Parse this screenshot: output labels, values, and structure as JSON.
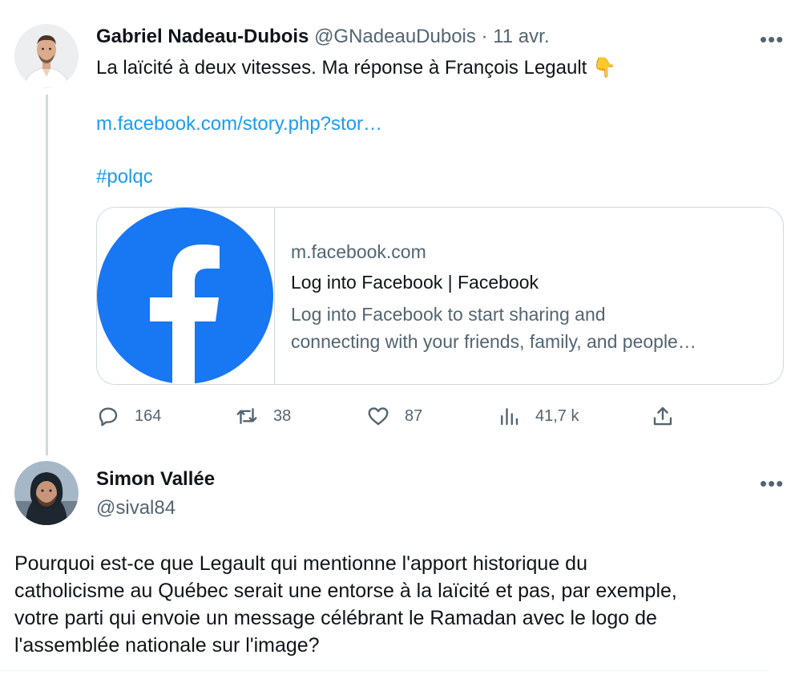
{
  "colors": {
    "text": "#0f1419",
    "muted": "#536471",
    "link": "#1d9bf0",
    "border": "#cfd9de",
    "facebook_blue": "#1877f2"
  },
  "tweet1": {
    "author_name": "Gabriel Nadeau-Dubois",
    "handle": "@GNadeauDubois",
    "separator": "·",
    "date": "11 avr.",
    "more_icon": "more-options-icon",
    "text": "La laïcité à deux vitesses. Ma réponse à François Legault 👇",
    "link_text": "m.facebook.com/story.php?stor…",
    "hashtag": "#polqc",
    "card": {
      "image_icon": "facebook-logo-icon",
      "domain": "m.facebook.com",
      "title": "Log into Facebook | Facebook",
      "description_line1": "Log into Facebook to start sharing and",
      "description_line2": "connecting with your friends, family, and people…"
    },
    "actions": {
      "reply_count": "164",
      "retweet_count": "38",
      "like_count": "87",
      "views_count": "41,7 k",
      "reply_icon": "reply-icon",
      "retweet_icon": "retweet-icon",
      "like_icon": "heart-icon",
      "views_icon": "analytics-icon",
      "share_icon": "share-icon"
    }
  },
  "tweet2": {
    "author_name": "Simon Vallée",
    "handle": "@sival84",
    "more_icon": "more-options-icon",
    "text_lines": [
      "Pourquoi est-ce que Legault qui mentionne l'apport historique du",
      "catholicisme au Québec serait une entorse à la laïcité et pas, par exemple,",
      "votre parti qui envoie un message célébrant le Ramadan avec le logo de",
      "l'assemblée nationale sur l'image?"
    ]
  }
}
